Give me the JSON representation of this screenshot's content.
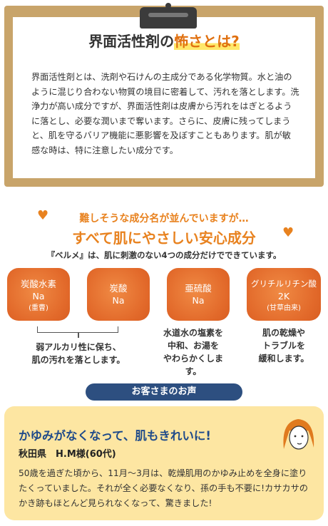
{
  "article": {
    "title_prefix": "界面活性剤の",
    "title_highlight": "怖さとは?",
    "body": "界面活性剤とは、洗剤や石けんの主成分である化学物質。水と油のように混じり合わない物質の境目に密着して、汚れを落とします。洗浄力が高い成分ですが、界面活性剤は皮膚から汚れをはぎとるように落とし、必要な潤いまで奪います。さらに、皮膚に残ってしまうと、肌を守るバリア機能に悪影響を及ぼすこともあります。肌が敏感な時は、特に注意したい成分です。"
  },
  "ingredients": {
    "tagline1": "難しそうな成分名が並んでいますが…",
    "tagline2": "すべて肌にやさしい安心成分",
    "lead": "『ベルメ』は、肌に刺激のない4つの成分だけでできています。",
    "items": [
      {
        "line1": "炭酸水素",
        "line2": "Na",
        "sub": "(重曹)"
      },
      {
        "line1": "炭酸",
        "line2": "Na",
        "sub": ""
      },
      {
        "line1": "亜硫酸",
        "line2": "Na",
        "sub": ""
      },
      {
        "line1": "グリチルリチン酸",
        "line2": "2K",
        "sub": "(甘草由来)"
      }
    ],
    "desc_1": [
      "弱アルカリ性に保ち、",
      "肌の汚れを落とします。"
    ],
    "desc_2": [
      "水道水の塩素を",
      "中和、お湯を",
      "やわらかくします。"
    ],
    "desc_3": [
      "肌の乾燥や",
      "トラブルを",
      "緩和します。"
    ]
  },
  "voice": {
    "label": "お客さまのお声",
    "title": "かゆみがなくなって、肌もきれいに!",
    "name": "秋田県　H.M様(60代)",
    "text": "50歳を過ぎた頃から、11月〜3月は、乾燥肌用のかゆみ止めを全身に塗りたくっていました。それが全く必要なくなり、孫の手も不要に!カサカサのかき跡もほとんど見られなくなって、驚きました!"
  },
  "colors": {
    "accent": "#e8821f",
    "board": "#c8a46a",
    "navy": "#2d4f80",
    "voice_bg": "#fde6a2"
  }
}
